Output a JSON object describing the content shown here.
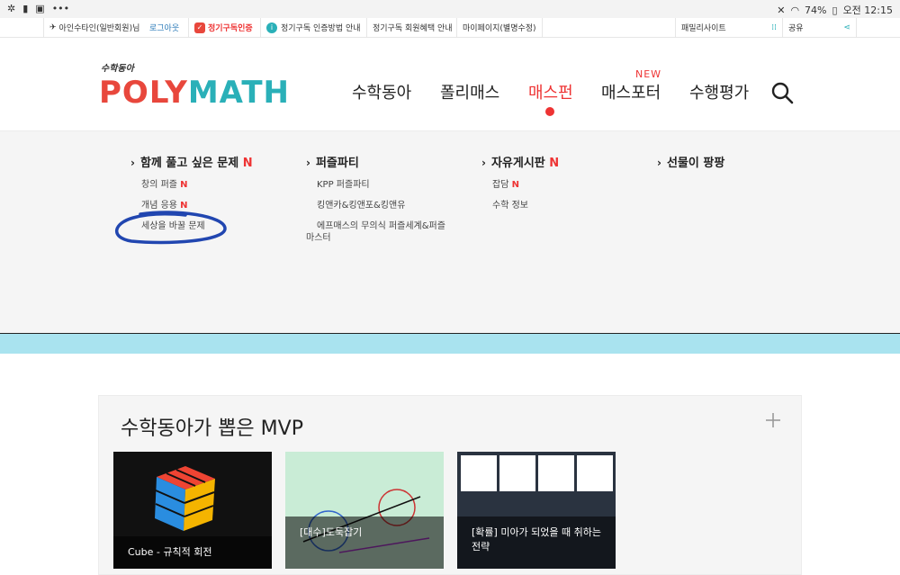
{
  "status_bar": {
    "left_icons": [
      "flower-icon",
      "trash-icon",
      "image-icon",
      "more-icon"
    ],
    "battery": "74%",
    "time": "오전 12:15"
  },
  "topbar": {
    "user": "아인수타인(일반회원)님",
    "logout": "로그아웃",
    "subscription_badge": "정기구독인증",
    "sub_guide": "정기구독 인증방법 안내",
    "member_benefits": "정기구독 회원혜택 안내",
    "mypage": "마이페이지(별명수정)",
    "family_sites": "패밀리사이트",
    "share": "공유"
  },
  "logo": {
    "small": "수학동아",
    "main_poly": "POLY",
    "main_math": "MATH"
  },
  "nav": {
    "items": [
      "수학동아",
      "폴리매스",
      "매스펀",
      "매스포터",
      "수행평가"
    ],
    "new_badge": "NEW"
  },
  "mega_menu": {
    "columns": [
      {
        "head": "함께 풀고 싶은 문제",
        "head_new": "N",
        "items": [
          {
            "label": "창의 퍼즐",
            "new": "N"
          },
          {
            "label": "개념 응용",
            "new": "N"
          },
          {
            "label": "세상을 바꿀 문제",
            "new": ""
          }
        ]
      },
      {
        "head": "퍼즐파티",
        "head_new": "",
        "items": [
          {
            "label": "KPP 퍼즐파티",
            "new": ""
          },
          {
            "label": "킹앤카&킹앤포&킹앤유",
            "new": ""
          },
          {
            "label": "에프매스의 무의식 퍼즐세계&퍼즐마스터",
            "new": ""
          }
        ]
      },
      {
        "head": "자유게시판",
        "head_new": "N",
        "items": [
          {
            "label": "잡담",
            "new": "N"
          },
          {
            "label": "수학 정보",
            "new": ""
          }
        ]
      },
      {
        "head": "선물이 팡팡",
        "head_new": "",
        "items": []
      }
    ]
  },
  "mvp": {
    "title": "수학동아가 뽑은 MVP",
    "cards": [
      {
        "caption": "Cube - 규칙적 회전"
      },
      {
        "caption": "[대수]도둑잡기"
      },
      {
        "caption": "[확률] 미아가 되었을 때 취하는 전략"
      }
    ]
  },
  "colors": {
    "accent": "#e33333",
    "teal": "#2ab0b8",
    "band": "#a9e3ef"
  }
}
